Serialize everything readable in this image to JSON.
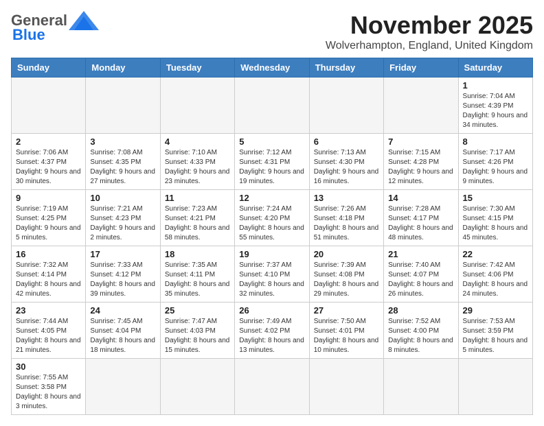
{
  "header": {
    "logo_general": "General",
    "logo_blue": "Blue",
    "month": "November 2025",
    "location": "Wolverhampton, England, United Kingdom"
  },
  "days_of_week": [
    "Sunday",
    "Monday",
    "Tuesday",
    "Wednesday",
    "Thursday",
    "Friday",
    "Saturday"
  ],
  "weeks": [
    [
      {
        "day": "",
        "info": ""
      },
      {
        "day": "",
        "info": ""
      },
      {
        "day": "",
        "info": ""
      },
      {
        "day": "",
        "info": ""
      },
      {
        "day": "",
        "info": ""
      },
      {
        "day": "",
        "info": ""
      },
      {
        "day": "1",
        "info": "Sunrise: 7:04 AM\nSunset: 4:39 PM\nDaylight: 9 hours\nand 34 minutes."
      }
    ],
    [
      {
        "day": "2",
        "info": "Sunrise: 7:06 AM\nSunset: 4:37 PM\nDaylight: 9 hours\nand 30 minutes."
      },
      {
        "day": "3",
        "info": "Sunrise: 7:08 AM\nSunset: 4:35 PM\nDaylight: 9 hours\nand 27 minutes."
      },
      {
        "day": "4",
        "info": "Sunrise: 7:10 AM\nSunset: 4:33 PM\nDaylight: 9 hours\nand 23 minutes."
      },
      {
        "day": "5",
        "info": "Sunrise: 7:12 AM\nSunset: 4:31 PM\nDaylight: 9 hours\nand 19 minutes."
      },
      {
        "day": "6",
        "info": "Sunrise: 7:13 AM\nSunset: 4:30 PM\nDaylight: 9 hours\nand 16 minutes."
      },
      {
        "day": "7",
        "info": "Sunrise: 7:15 AM\nSunset: 4:28 PM\nDaylight: 9 hours\nand 12 minutes."
      },
      {
        "day": "8",
        "info": "Sunrise: 7:17 AM\nSunset: 4:26 PM\nDaylight: 9 hours\nand 9 minutes."
      }
    ],
    [
      {
        "day": "9",
        "info": "Sunrise: 7:19 AM\nSunset: 4:25 PM\nDaylight: 9 hours\nand 5 minutes."
      },
      {
        "day": "10",
        "info": "Sunrise: 7:21 AM\nSunset: 4:23 PM\nDaylight: 9 hours\nand 2 minutes."
      },
      {
        "day": "11",
        "info": "Sunrise: 7:23 AM\nSunset: 4:21 PM\nDaylight: 8 hours\nand 58 minutes."
      },
      {
        "day": "12",
        "info": "Sunrise: 7:24 AM\nSunset: 4:20 PM\nDaylight: 8 hours\nand 55 minutes."
      },
      {
        "day": "13",
        "info": "Sunrise: 7:26 AM\nSunset: 4:18 PM\nDaylight: 8 hours\nand 51 minutes."
      },
      {
        "day": "14",
        "info": "Sunrise: 7:28 AM\nSunset: 4:17 PM\nDaylight: 8 hours\nand 48 minutes."
      },
      {
        "day": "15",
        "info": "Sunrise: 7:30 AM\nSunset: 4:15 PM\nDaylight: 8 hours\nand 45 minutes."
      }
    ],
    [
      {
        "day": "16",
        "info": "Sunrise: 7:32 AM\nSunset: 4:14 PM\nDaylight: 8 hours\nand 42 minutes."
      },
      {
        "day": "17",
        "info": "Sunrise: 7:33 AM\nSunset: 4:12 PM\nDaylight: 8 hours\nand 39 minutes."
      },
      {
        "day": "18",
        "info": "Sunrise: 7:35 AM\nSunset: 4:11 PM\nDaylight: 8 hours\nand 35 minutes."
      },
      {
        "day": "19",
        "info": "Sunrise: 7:37 AM\nSunset: 4:10 PM\nDaylight: 8 hours\nand 32 minutes."
      },
      {
        "day": "20",
        "info": "Sunrise: 7:39 AM\nSunset: 4:08 PM\nDaylight: 8 hours\nand 29 minutes."
      },
      {
        "day": "21",
        "info": "Sunrise: 7:40 AM\nSunset: 4:07 PM\nDaylight: 8 hours\nand 26 minutes."
      },
      {
        "day": "22",
        "info": "Sunrise: 7:42 AM\nSunset: 4:06 PM\nDaylight: 8 hours\nand 24 minutes."
      }
    ],
    [
      {
        "day": "23",
        "info": "Sunrise: 7:44 AM\nSunset: 4:05 PM\nDaylight: 8 hours\nand 21 minutes."
      },
      {
        "day": "24",
        "info": "Sunrise: 7:45 AM\nSunset: 4:04 PM\nDaylight: 8 hours\nand 18 minutes."
      },
      {
        "day": "25",
        "info": "Sunrise: 7:47 AM\nSunset: 4:03 PM\nDaylight: 8 hours\nand 15 minutes."
      },
      {
        "day": "26",
        "info": "Sunrise: 7:49 AM\nSunset: 4:02 PM\nDaylight: 8 hours\nand 13 minutes."
      },
      {
        "day": "27",
        "info": "Sunrise: 7:50 AM\nSunset: 4:01 PM\nDaylight: 8 hours\nand 10 minutes."
      },
      {
        "day": "28",
        "info": "Sunrise: 7:52 AM\nSunset: 4:00 PM\nDaylight: 8 hours\nand 8 minutes."
      },
      {
        "day": "29",
        "info": "Sunrise: 7:53 AM\nSunset: 3:59 PM\nDaylight: 8 hours\nand 5 minutes."
      }
    ],
    [
      {
        "day": "30",
        "info": "Sunrise: 7:55 AM\nSunset: 3:58 PM\nDaylight: 8 hours\nand 3 minutes."
      },
      {
        "day": "",
        "info": ""
      },
      {
        "day": "",
        "info": ""
      },
      {
        "day": "",
        "info": ""
      },
      {
        "day": "",
        "info": ""
      },
      {
        "day": "",
        "info": ""
      },
      {
        "day": "",
        "info": ""
      }
    ]
  ]
}
